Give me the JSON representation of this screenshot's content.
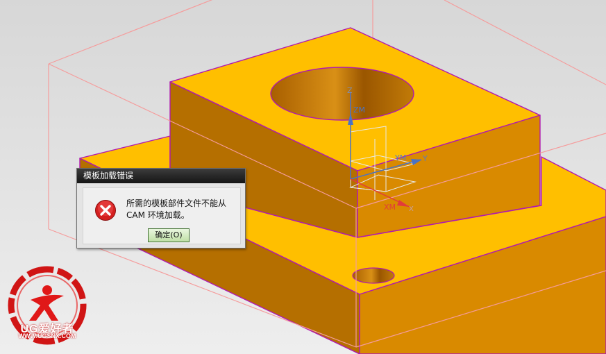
{
  "dialog": {
    "title": "模板加载错误",
    "message_line1": "所需的模板部件文件不能从",
    "message_line2": "CAM 环境加载。",
    "ok_label": "确定(O)"
  },
  "csys": {
    "z_label": "Z",
    "zm_label": "ZM",
    "ym_label": "YM",
    "y_label": "Y",
    "xm_label": "XM",
    "x_label": "X"
  },
  "watermark": {
    "brand": "UG爱好者",
    "url": "WWW.UGSNX.COM"
  },
  "colors": {
    "part_top": "#FFBF00",
    "part_side_light": "#D98A00",
    "part_side_dark": "#B56F00",
    "edge": "#B01AB0",
    "blank_box": "#F59C9C",
    "csys_blue": "#4A73C6",
    "csys_red": "#E23B3B",
    "error_red": "#D41F1F"
  }
}
